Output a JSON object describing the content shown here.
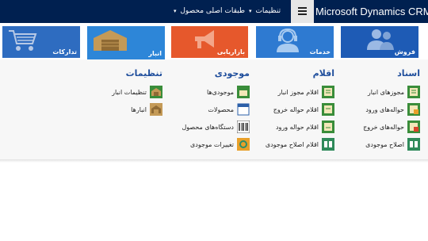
{
  "header": {
    "brand": "Microsoft Dynamics CRM",
    "nav": [
      {
        "label": "تنظیمات"
      },
      {
        "label": "طبقات اصلی محصول"
      }
    ]
  },
  "tiles": [
    {
      "label": "فروش",
      "color": "#1e5bb5",
      "icon": "people-icon"
    },
    {
      "label": "خدمات",
      "color": "#2e7ad1",
      "icon": "headset-icon"
    },
    {
      "label": "بازاریابی",
      "color": "#e6582c",
      "icon": "megaphone-icon"
    },
    {
      "label": "انبار",
      "color": "#2d86d8",
      "icon": "warehouse-icon"
    },
    {
      "label": "تدارکات",
      "color": "#2e6cc0",
      "icon": "cart-icon"
    }
  ],
  "groups": {
    "documents": {
      "title": "اسناد",
      "items": [
        {
          "label": "مجوزهای انبار",
          "icon": "permit-icon"
        },
        {
          "label": "حواله‌های ورود",
          "icon": "entry-slip-icon"
        },
        {
          "label": "حواله‌های خروج",
          "icon": "exit-slip-icon"
        },
        {
          "label": "اصلاح موجودی",
          "icon": "adjust-icon"
        }
      ]
    },
    "items": {
      "title": "اقلام",
      "items": [
        {
          "label": "اقلام مجوز انبار",
          "icon": "permit-lines-icon"
        },
        {
          "label": "اقلام حواله خروج",
          "icon": "exit-lines-icon"
        },
        {
          "label": "اقلام حواله ورود",
          "icon": "entry-lines-icon"
        },
        {
          "label": "اقلام اصلاح موجودی",
          "icon": "adjust-lines-icon"
        }
      ]
    },
    "inventory": {
      "title": "موجودی",
      "items": [
        {
          "label": "موجودی‌ها",
          "icon": "stock-icon"
        },
        {
          "label": "محصولات",
          "icon": "products-icon"
        },
        {
          "label": "دستگاه‌های محصول",
          "icon": "barcode-icon"
        },
        {
          "label": "تغییرات موجودی",
          "icon": "changes-icon"
        }
      ]
    },
    "settings": {
      "title": "تنظیمات",
      "items": [
        {
          "label": "تنظیمات انبار",
          "icon": "warehouse-settings-icon"
        },
        {
          "label": "انبارها",
          "icon": "warehouses-icon"
        }
      ]
    }
  }
}
